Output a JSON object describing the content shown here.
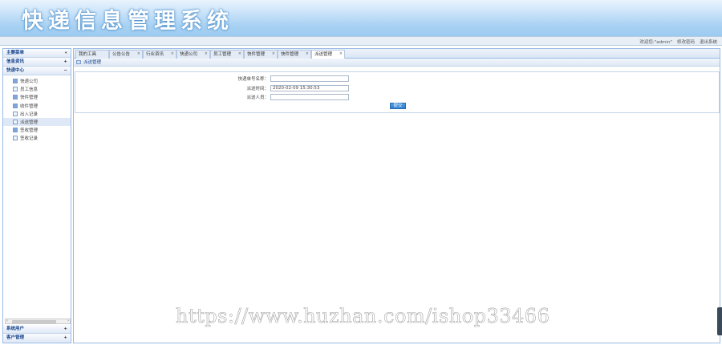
{
  "app": {
    "title": "快递信息管理系统"
  },
  "status": {
    "welcome": "欢迎您:\"admin\"",
    "change_password": "修改密码",
    "logout": "退出系统"
  },
  "sidebar": {
    "main_menu": {
      "label": "主要菜单",
      "toggle": "«"
    },
    "groups_top": [
      {
        "label": "信息资讯",
        "toggle": "+"
      },
      {
        "label": "快递中心",
        "toggle": "−"
      }
    ],
    "items": [
      {
        "label": "快递公司"
      },
      {
        "label": "员工信息"
      },
      {
        "label": "快件管理"
      },
      {
        "label": "收件管理"
      },
      {
        "label": "出入记录"
      },
      {
        "label": "派送管理"
      },
      {
        "label": "签收管理"
      },
      {
        "label": "签收记录"
      }
    ],
    "groups_bottom": [
      {
        "label": "系统用户",
        "toggle": "+"
      },
      {
        "label": "客户管理",
        "toggle": "+"
      }
    ]
  },
  "tabs": [
    {
      "label": "我的工具"
    },
    {
      "label": "公告公告"
    },
    {
      "label": "行业资讯"
    },
    {
      "label": "快递公司"
    },
    {
      "label": "员工管理"
    },
    {
      "label": "快件管理"
    },
    {
      "label": "快件管理"
    },
    {
      "label": "派送管理"
    }
  ],
  "panel": {
    "title": "派送管理"
  },
  "form": {
    "tracking_label": "快递单号名称：",
    "tracking_value": "",
    "time_label": "派送时间：",
    "time_value": "2020-02-09 15:30:53",
    "courier_label": "派送人员：",
    "courier_value": "",
    "submit_label": "提交"
  },
  "watermark": "https://www.huzhan.com/ishop33466"
}
